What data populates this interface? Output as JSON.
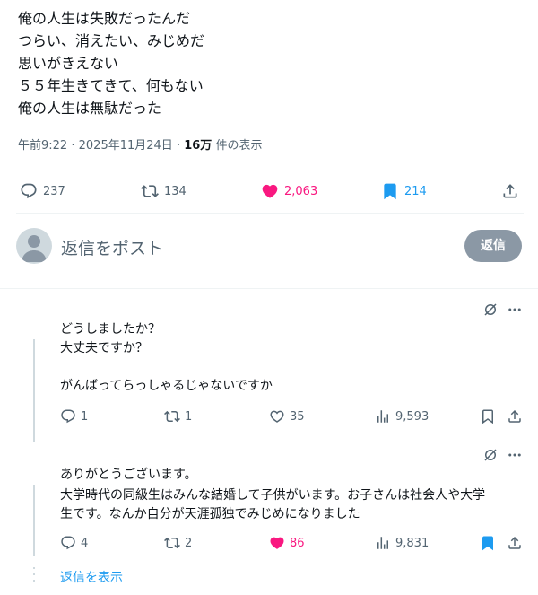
{
  "post": {
    "lines": [
      "俺の人生は失敗だったんだ",
      "つらい、消えたい、みじめだ",
      "思いがきえない",
      "５５年生きてきて、何もない",
      "俺の人生は無駄だった"
    ],
    "time": "午前9:22",
    "date": "2025年11月24日",
    "views_count": "16万",
    "views_label": "件の表示",
    "sep": "·",
    "actions": {
      "replies": "237",
      "reposts": "134",
      "likes": "2,063",
      "bookmarks": "214"
    }
  },
  "reply_box": {
    "placeholder": "返信をポスト",
    "button_label": "返信"
  },
  "replies": [
    {
      "lines": [
        "どうしましたか？",
        "大丈夫ですか？",
        "",
        "がんばってらっしゃるじゃないですか"
      ],
      "replies": "1",
      "reposts": "1",
      "likes": "35",
      "views": "9,593",
      "liked": false,
      "bookmarked": false
    },
    {
      "lines": [
        "ありがとうございます。",
        "大学時代の同級生はみんな結婚して子供がいます。お子さんは社会人や大学",
        "生です。なんか自分が天涯孤独でみじめになりました"
      ],
      "replies": "4",
      "reposts": "2",
      "likes": "86",
      "views": "9,831",
      "liked": true,
      "bookmarked": true
    }
  ],
  "show_replies_label": "返信を表示",
  "colors": {
    "text": "#0f1419",
    "secondary": "#536471",
    "like": "#f91880",
    "bookmark": "#1d9bf0",
    "divider": "#eff3f4"
  },
  "icons": [
    "reply-icon",
    "repost-icon",
    "like-icon",
    "bookmark-icon",
    "share-icon",
    "views-icon",
    "grok-icon",
    "more-icon"
  ]
}
